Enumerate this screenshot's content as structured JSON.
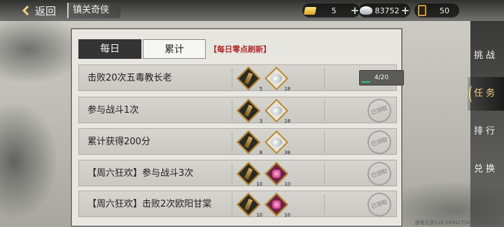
{
  "header": {
    "back_label": "返回",
    "title": "镇关奇侠",
    "resources": [
      {
        "icon": "gold-ingot-icon",
        "value": "5"
      },
      {
        "icon": "silver-icon",
        "value": "83752"
      },
      {
        "icon": "scroll-icon",
        "value": "50"
      }
    ]
  },
  "tabs": [
    {
      "label": "每日",
      "active": true
    },
    {
      "label": "累计",
      "active": false
    }
  ],
  "refresh_note": "【每日零点刷新】",
  "tasks": [
    {
      "name": "击败20次五毒教长老",
      "rewards": [
        {
          "icon": "badge-icon",
          "count": "5"
        },
        {
          "icon": "silver-pile-icon",
          "count": "18"
        }
      ],
      "status": "progress",
      "progress_text": "4/20",
      "progress": 0.2
    },
    {
      "name": "参与战斗1次",
      "rewards": [
        {
          "icon": "badge-icon",
          "count": "3"
        },
        {
          "icon": "silver-pile-icon",
          "count": "18"
        }
      ],
      "status": "claimed",
      "stamp": "已领取"
    },
    {
      "name": "累计获得200分",
      "rewards": [
        {
          "icon": "badge-icon",
          "count": "8"
        },
        {
          "icon": "silver-pile-icon",
          "count": "38"
        }
      ],
      "status": "claimed",
      "stamp": "已领取"
    },
    {
      "name": "【周六狂欢】参与战斗3次",
      "rewards": [
        {
          "icon": "badge-icon",
          "count": "10"
        },
        {
          "icon": "gem-icon",
          "count": "10"
        }
      ],
      "status": "claimed",
      "stamp": "已领取"
    },
    {
      "name": "【周六狂欢】击败2次欧阳甘棠",
      "rewards": [
        {
          "icon": "badge-icon",
          "count": "10"
        },
        {
          "icon": "gem-icon",
          "count": "10"
        }
      ],
      "status": "claimed",
      "stamp": "已领取"
    }
  ],
  "sidenav": [
    {
      "label": "挑战",
      "active": false
    },
    {
      "label": "任务",
      "active": true
    },
    {
      "label": "排行",
      "active": false
    },
    {
      "label": "兑换",
      "active": false
    }
  ],
  "footer": "游逸天涯118:289427343 12162352"
}
